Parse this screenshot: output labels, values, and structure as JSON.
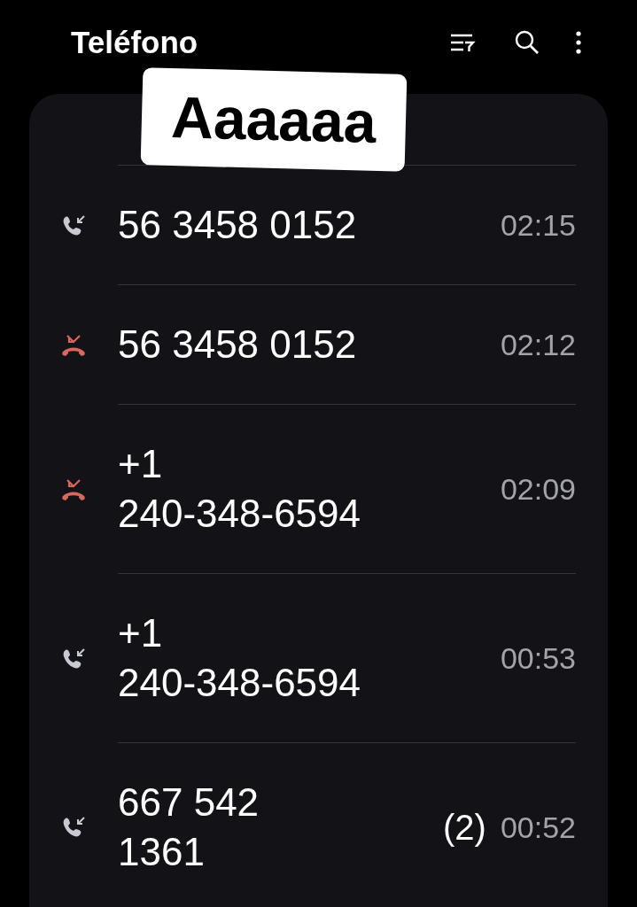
{
  "header": {
    "title": "Teléfono"
  },
  "sticker": {
    "text": "Aaaaaa"
  },
  "calls": [
    {
      "kind": "incoming",
      "number": "56 3458 0152",
      "time": "02:15"
    },
    {
      "kind": "missed",
      "number": "56 3458 0152",
      "time": "02:12"
    },
    {
      "kind": "missed",
      "number": "+1 240-348-6594",
      "time": "02:09"
    },
    {
      "kind": "incoming",
      "number": "+1 240-348-6594",
      "time": "00:53"
    },
    {
      "kind": "incoming",
      "number": "667 542 1361",
      "count": "(2)",
      "time": "00:52"
    }
  ]
}
